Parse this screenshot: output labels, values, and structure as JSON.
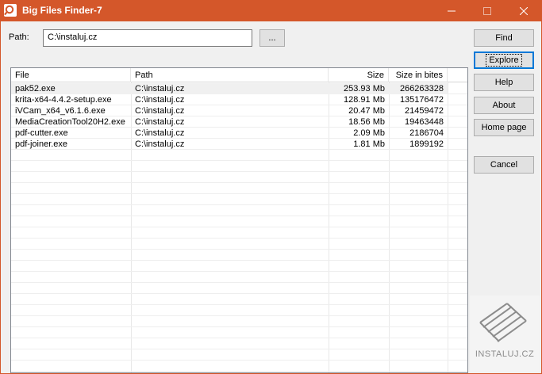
{
  "window": {
    "title": "Big Files Finder-7",
    "accent_color": "#d4572a",
    "icon": "magnifier-icon"
  },
  "path": {
    "label": "Path:",
    "value": "C:\\instaluj.cz",
    "browse_label": "..."
  },
  "buttons": {
    "find": "Find",
    "explore": "Explore",
    "help": "Help",
    "about": "About",
    "home_page": "Home page",
    "cancel": "Cancel"
  },
  "table": {
    "columns": [
      "File",
      "Path",
      "Size",
      "Size in bites"
    ],
    "rows": [
      {
        "file": "pak52.exe",
        "path": "C:\\instaluj.cz",
        "size": "253.93 Mb",
        "bites": "266263328"
      },
      {
        "file": "krita-x64-4.4.2-setup.exe",
        "path": "C:\\instaluj.cz",
        "size": "128.91 Mb",
        "bites": "135176472"
      },
      {
        "file": "iVCam_x64_v6.1.6.exe",
        "path": "C:\\instaluj.cz",
        "size": "20.47 Mb",
        "bites": "21459472"
      },
      {
        "file": "MediaCreationTool20H2.exe",
        "path": "C:\\instaluj.cz",
        "size": "18.56 Mb",
        "bites": "19463448"
      },
      {
        "file": "pdf-cutter.exe",
        "path": "C:\\instaluj.cz",
        "size": "2.09 Mb",
        "bites": "2186704"
      },
      {
        "file": "pdf-joiner.exe",
        "path": "C:\\instaluj.cz",
        "size": "1.81 Mb",
        "bites": "1899192"
      }
    ]
  },
  "watermark": {
    "text": "INSTALUJ.CZ",
    "icon": "instaluj-logo-icon"
  }
}
